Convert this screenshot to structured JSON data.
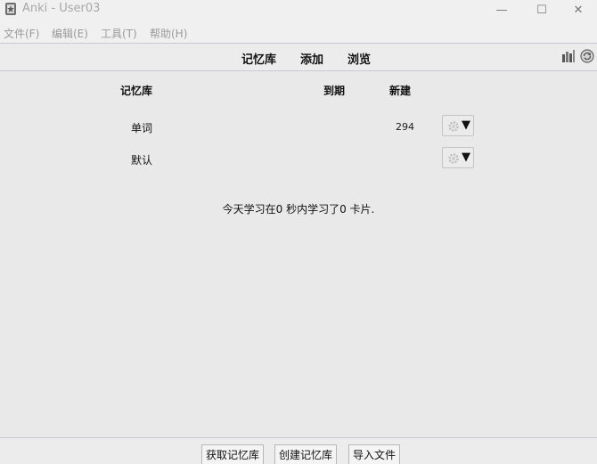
{
  "window": {
    "title": "Anki - User03",
    "minimize_glyph": "—",
    "maximize_glyph": "☐",
    "close_glyph": "✕"
  },
  "menu": {
    "items": [
      {
        "label": "文件(F)"
      },
      {
        "label": "编辑(E)"
      },
      {
        "label": "工具(T)"
      },
      {
        "label": "帮助(H)"
      }
    ]
  },
  "toolbar": {
    "decks_label": "记忆库",
    "add_label": "添加",
    "browse_label": "浏览",
    "right_icons": [
      "stats-icon",
      "sync-icon"
    ]
  },
  "deck_table": {
    "headers": {
      "deck": "记忆库",
      "due": "到期",
      "new": "新建"
    },
    "rows": [
      {
        "name": "单词",
        "due": "",
        "new": "294"
      },
      {
        "name": "默认",
        "due": "",
        "new": ""
      }
    ],
    "options_arrow": "▼"
  },
  "study_message": "今天学习在0 秒内学习了0 卡片.",
  "bottom": {
    "get_shared": "获取记忆库",
    "create_deck": "创建记忆库",
    "import_file": "导入文件"
  },
  "colors": {
    "background": "#e9e9e9",
    "divider": "#c9c9d6",
    "menu_text_disabled": "#9a9a9a"
  }
}
